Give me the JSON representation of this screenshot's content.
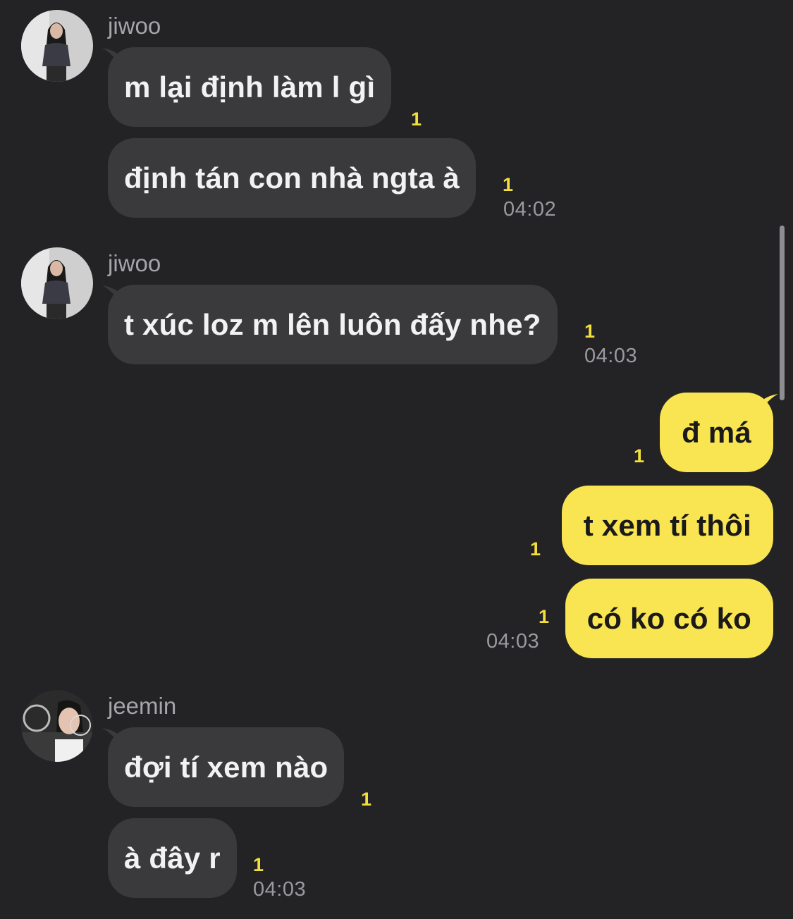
{
  "conversation": {
    "groups": [
      {
        "sender": "jiwoo",
        "avatar_icon": "profile-photo-jiwoo",
        "messages": [
          {
            "text": "m lại định làm l gì",
            "unread": "1"
          },
          {
            "text": "định tán con nhà ngta à",
            "unread": "1",
            "time": "04:02"
          }
        ]
      },
      {
        "sender": "jiwoo",
        "avatar_icon": "profile-photo-jiwoo",
        "messages": [
          {
            "text": "t xúc loz m lên luôn đấy nhe?",
            "unread": "1",
            "time": "04:03"
          }
        ]
      },
      {
        "sender": "me",
        "messages": [
          {
            "text": "đ má",
            "unread": "1"
          },
          {
            "text": "t xem tí thôi",
            "unread": "1"
          },
          {
            "text": "có ko có ko",
            "unread": "1",
            "time": "04:03"
          }
        ]
      },
      {
        "sender": "jeemin",
        "avatar_icon": "profile-photo-jeemin",
        "messages": [
          {
            "text": "đợi tí xem nào",
            "unread": "1"
          },
          {
            "text": "à đây r",
            "unread": "1",
            "time": "04:03"
          }
        ]
      }
    ]
  },
  "colors": {
    "background": "#232326",
    "incoming_bubble": "#3a3a3d",
    "outgoing_bubble": "#f9e451",
    "unread_count": "#f4de3c",
    "timestamp": "#9a9a9e"
  }
}
